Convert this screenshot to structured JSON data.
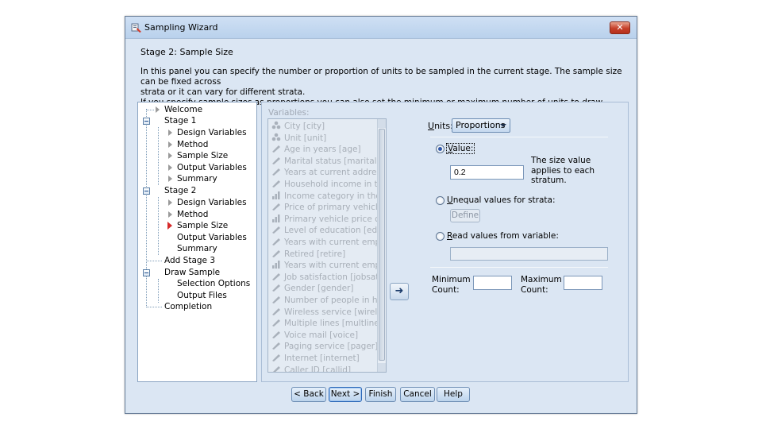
{
  "window": {
    "title": "Sampling Wizard",
    "close_glyph": "✕"
  },
  "header": {
    "stage_title": "Stage 2: Sample Size",
    "description_line1": "In this panel you can specify the number or proportion of units to be sampled in the current stage. The sample size can be fixed across",
    "description_line2": "strata or it can vary for different strata.",
    "description_line3": "If you specify sample sizes as proportions you can also set the minimum or maximum number of units to draw."
  },
  "nav": {
    "items": [
      {
        "label": "Welcome"
      },
      {
        "label": "Stage 1"
      },
      {
        "label": "Design Variables"
      },
      {
        "label": "Method"
      },
      {
        "label": "Sample Size"
      },
      {
        "label": "Output Variables"
      },
      {
        "label": "Summary"
      },
      {
        "label": "Stage 2"
      },
      {
        "label": "Design Variables"
      },
      {
        "label": "Method"
      },
      {
        "label": "Sample Size"
      },
      {
        "label": "Output Variables"
      },
      {
        "label": "Summary"
      },
      {
        "label": "Add Stage 3"
      },
      {
        "label": "Draw Sample"
      },
      {
        "label": "Selection Options"
      },
      {
        "label": "Output Files"
      },
      {
        "label": "Completion"
      }
    ]
  },
  "variables": {
    "label": "Variables:",
    "items": [
      {
        "label": "City [city]",
        "icon": "nominal-icon"
      },
      {
        "label": "Unit [unit]",
        "icon": "nominal-icon"
      },
      {
        "label": "Age in years [age]",
        "icon": "scale-icon"
      },
      {
        "label": "Marital status [marital]",
        "icon": "scale-icon"
      },
      {
        "label": "Years at current address",
        "icon": "scale-icon"
      },
      {
        "label": "Household income in th...",
        "icon": "scale-icon"
      },
      {
        "label": "Income category in thou...",
        "icon": "ordinal-icon"
      },
      {
        "label": "Price of primary vehicle ...",
        "icon": "scale-icon"
      },
      {
        "label": "Primary vehicle price ca...",
        "icon": "ordinal-icon"
      },
      {
        "label": "Level of education [ed]",
        "icon": "scale-icon"
      },
      {
        "label": "Years with current empl...",
        "icon": "scale-icon"
      },
      {
        "label": "Retired [retire]",
        "icon": "scale-icon"
      },
      {
        "label": "Years with current empl...",
        "icon": "ordinal-icon"
      },
      {
        "label": "Job satisfaction [jobsat]",
        "icon": "scale-icon"
      },
      {
        "label": "Gender [gender]",
        "icon": "scale-icon"
      },
      {
        "label": "Number of people in ho...",
        "icon": "scale-icon"
      },
      {
        "label": "Wireless service [wirele...",
        "icon": "scale-icon"
      },
      {
        "label": "Multiple lines [multline]",
        "icon": "scale-icon"
      },
      {
        "label": "Voice mail [voice]",
        "icon": "scale-icon"
      },
      {
        "label": "Paging service [pager]",
        "icon": "scale-icon"
      },
      {
        "label": "Internet [internet]",
        "icon": "scale-icon"
      },
      {
        "label": "Caller ID [callid]",
        "icon": "scale-icon"
      }
    ]
  },
  "move_button": {
    "glyph": "➜"
  },
  "units": {
    "label": "Units:",
    "selected": "Proportions"
  },
  "value_option": {
    "label": "Value:",
    "value": "0.2",
    "note": "The size value applies to each stratum."
  },
  "unequal_option": {
    "label": "Unequal values for strata:",
    "define_label": "Define"
  },
  "read_option": {
    "label": "Read values from variable:",
    "value": ""
  },
  "minimum": {
    "label_line1": "Minimum",
    "label_line2": "Count:",
    "value": ""
  },
  "maximum": {
    "label_line1": "Maximum",
    "label_line2": "Count:",
    "value": ""
  },
  "buttons": {
    "back": "< Back",
    "next": "Next >",
    "finish": "Finish",
    "cancel": "Cancel",
    "help": "Help"
  }
}
